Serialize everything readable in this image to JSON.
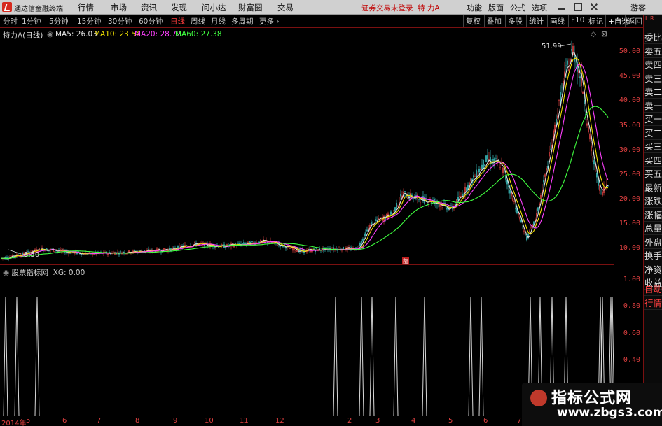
{
  "app": {
    "title": "通达信金融终端",
    "menu": [
      "行情",
      "市场",
      "资讯",
      "发现",
      "问小达",
      "财富圈",
      "交易"
    ],
    "trade_status": "证券交易未登录",
    "stock_name": "特 力A",
    "right_menu": [
      "功能",
      "版面",
      "公式",
      "选项"
    ],
    "guest": "游客"
  },
  "periods": {
    "items": [
      "分时",
      "1分钟",
      "5分钟",
      "15分钟",
      "30分钟",
      "60分钟",
      "日线",
      "周线",
      "月线",
      "多周期",
      "更多"
    ],
    "active": "日线"
  },
  "toolbar": [
    "复权",
    "叠加",
    "多股",
    "统计",
    "画线",
    "F10",
    "标记",
    "+自选",
    "返回"
  ],
  "chart_info": {
    "title": "特力A(日线)",
    "ma": [
      {
        "label": "MA5: 26.03",
        "color": "#e0e0e0"
      },
      {
        "label": "MA10: 23.54",
        "color": "#f0e000"
      },
      {
        "label": "MA20: 28.72",
        "color": "#ff40ff"
      },
      {
        "label": "MA60: 27.38",
        "color": "#40ff40"
      }
    ]
  },
  "price_axis": [
    "50.00",
    "45.00",
    "40.00",
    "35.00",
    "30.00",
    "25.00",
    "20.00",
    "15.00",
    "10.00"
  ],
  "annotations": {
    "high": "51.99",
    "low": "8.50",
    "marker": "龍"
  },
  "indicator": {
    "title": "股票指标网",
    "value": "XG: 0.00",
    "axis": [
      "1.00",
      "0.80",
      "0.60",
      "0.40"
    ]
  },
  "chart_data": [
    {
      "type": "line",
      "title": "特力A(日线)",
      "ylim": [
        8,
        53
      ],
      "series": [
        {
          "name": "MA5",
          "color": "#e0e0e0"
        },
        {
          "name": "MA10",
          "color": "#f0e000"
        },
        {
          "name": "MA20",
          "color": "#ff40ff"
        },
        {
          "name": "MA60",
          "color": "#40ff40"
        }
      ],
      "annotations": [
        "51.99",
        "8.50"
      ]
    },
    {
      "type": "bar",
      "title": "股票指标网",
      "ylim": [
        0,
        1
      ],
      "series": [
        {
          "name": "XG",
          "values": [
            1,
            1,
            1,
            1,
            1,
            1,
            1,
            1,
            1,
            1,
            1,
            1,
            1,
            1,
            1,
            1,
            1,
            1
          ]
        }
      ]
    }
  ],
  "date_axis": [
    "2014年",
    "5",
    "6",
    "7",
    "8",
    "9",
    "10",
    "11",
    "12",
    "2",
    "3",
    "4",
    "5",
    "6",
    "7"
  ],
  "sidebar": {
    "top": "L R",
    "items": [
      "委比",
      "卖五",
      "卖四",
      "卖三",
      "卖二",
      "卖一",
      "买一",
      "买二",
      "买三",
      "买四",
      "买五",
      "最新",
      "涨跌",
      "涨幅",
      "总量",
      "外盘",
      "换手",
      "净资",
      "收益",
      "自动",
      "行情"
    ]
  },
  "watermark": {
    "line1": "指标公式网",
    "line2": "www.zbgs3.com"
  }
}
